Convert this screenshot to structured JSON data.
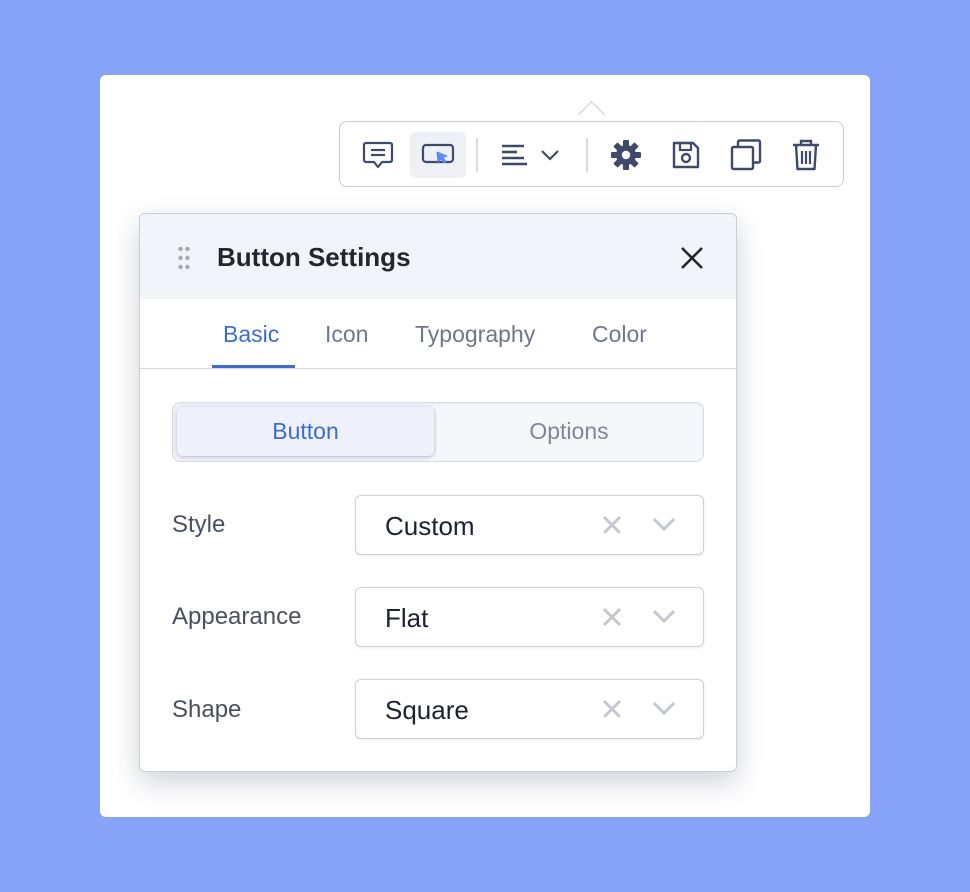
{
  "panel": {
    "title": "Button Settings",
    "tabs": [
      {
        "label": "Basic",
        "active": true
      },
      {
        "label": "Icon",
        "active": false
      },
      {
        "label": "Typography",
        "active": false
      },
      {
        "label": "Color",
        "active": false
      }
    ],
    "segment": {
      "options": [
        "Button",
        "Options"
      ],
      "selected": "Button"
    },
    "fields": [
      {
        "label": "Style",
        "value": "Custom"
      },
      {
        "label": "Appearance",
        "value": "Flat"
      },
      {
        "label": "Shape",
        "value": "Square"
      }
    ]
  },
  "toolbar": {
    "icons": [
      "comment-icon",
      "select-cursor-icon",
      "align-left-icon",
      "chevron-down-icon",
      "gear-icon",
      "save-icon",
      "duplicate-icon",
      "trash-icon"
    ]
  },
  "colors": {
    "background": "#86a3f7",
    "accent": "#3d6ccf",
    "icon": "#3f4a6b"
  }
}
